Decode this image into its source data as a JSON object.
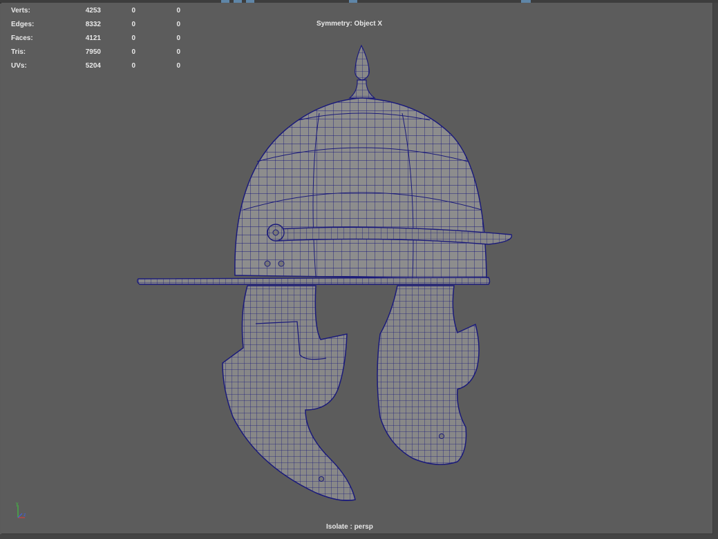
{
  "hud": {
    "rows": [
      {
        "label": "Verts:",
        "v1": "4253",
        "v2": "0",
        "v3": "0"
      },
      {
        "label": "Edges:",
        "v1": "8332",
        "v2": "0",
        "v3": "0"
      },
      {
        "label": "Faces:",
        "v1": "4121",
        "v2": "0",
        "v3": "0"
      },
      {
        "label": "Tris:",
        "v1": "7950",
        "v2": "0",
        "v3": "0"
      },
      {
        "label": "UVs:",
        "v1": "5204",
        "v2": "0",
        "v3": "0"
      }
    ]
  },
  "symmetry_label": "Symmetry: Object X",
  "isolate_label": "Isolate : persp",
  "axis": {
    "y": "y",
    "z": "z"
  },
  "colors": {
    "viewport_bg": "#5c5c5c",
    "wire": "#1a1a7a",
    "mesh_fill": "#8c8c8c",
    "hud_text": "#e8e8e8",
    "axis_x": "#d04040",
    "axis_y": "#40c040",
    "axis_z": "#4060e0"
  },
  "icons": [
    "helmet-mesh",
    "view-axis-gizmo"
  ]
}
